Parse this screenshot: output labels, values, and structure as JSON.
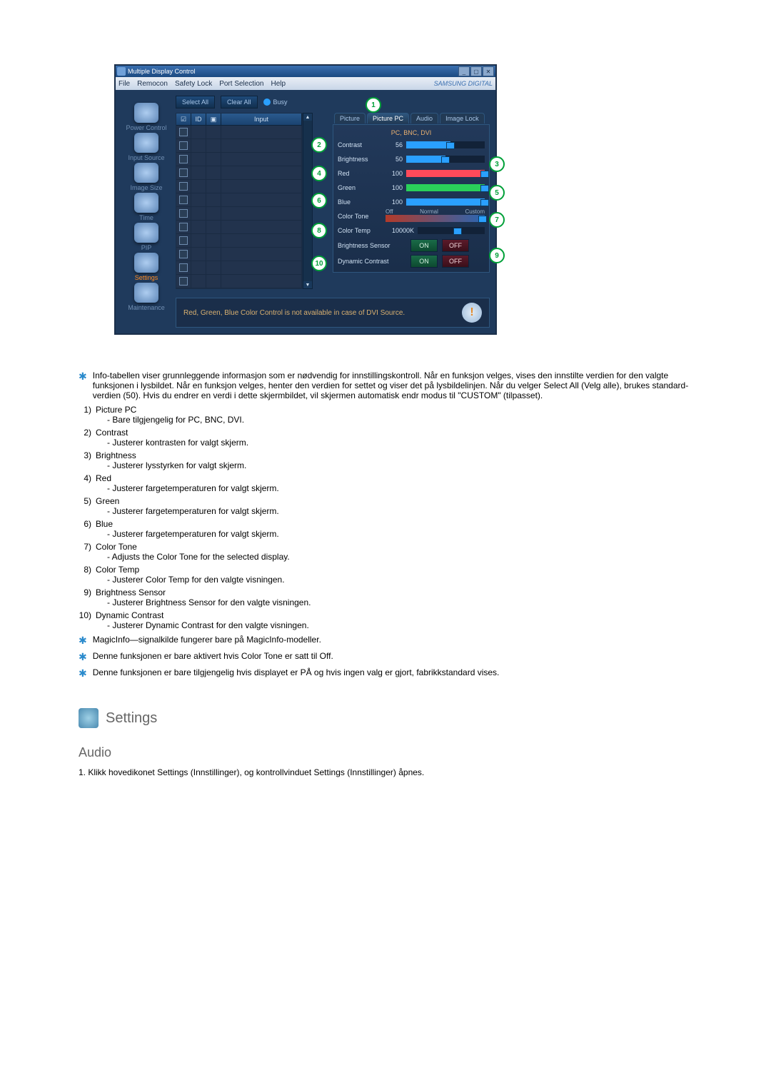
{
  "app": {
    "title": "Multiple Display Control",
    "menubar": [
      "File",
      "Remocon",
      "Safety Lock",
      "Port Selection",
      "Help"
    ],
    "brand": "SAMSUNG DIGITAL",
    "sidebar": [
      {
        "label": "Power Control"
      },
      {
        "label": "Input Source"
      },
      {
        "label": "Image Size"
      },
      {
        "label": "Time"
      },
      {
        "label": "PIP"
      },
      {
        "label": "Settings",
        "active": true
      },
      {
        "label": "Maintenance"
      }
    ],
    "buttons": {
      "select_all": "Select All",
      "clear_all": "Clear All",
      "busy": "Busy"
    },
    "table": {
      "headers": [
        "",
        "ID",
        "",
        "Input"
      ],
      "rows": 12
    },
    "callouts_top": "1",
    "callouts_right": [
      "3",
      "5",
      "7",
      "9"
    ],
    "callouts_left": [
      "2",
      "4",
      "6",
      "8",
      "10"
    ],
    "tabs": [
      "Picture",
      "Picture PC",
      "Audio",
      "Image Lock"
    ],
    "active_tab": "Picture PC",
    "src_label": "PC, BNC, DVI",
    "sliders": [
      {
        "label": "Contrast",
        "value": 56,
        "fill": 56,
        "color": "#2aa0ff"
      },
      {
        "label": "Brightness",
        "value": 50,
        "fill": 50,
        "color": "#2aa0ff"
      },
      {
        "label": "Red",
        "value": 100,
        "fill": 100,
        "color": "#ff4a5a"
      },
      {
        "label": "Green",
        "value": 100,
        "fill": 100,
        "color": "#2ad05a"
      },
      {
        "label": "Blue",
        "value": 100,
        "fill": 100,
        "color": "#2aa0ff"
      }
    ],
    "colortone": {
      "label": "Color Tone",
      "opts": [
        "Off",
        "Normal",
        "Custom"
      ],
      "sel": 2
    },
    "colortemp": {
      "label": "Color Temp",
      "value": "10000K",
      "fill": 60
    },
    "toggles": [
      {
        "label": "Brightness Sensor",
        "on": "ON",
        "off": "OFF"
      },
      {
        "label": "Dynamic Contrast",
        "on": "ON",
        "off": "OFF"
      }
    ],
    "footer_note": "Red, Green, Blue Color Control is not available in case of DVI Source."
  },
  "doc": {
    "star1": "Info-tabellen viser grunnleggende informasjon som er nødvendig for innstillingskontroll. Når en funksjon velges, vises den innstilte verdien for den valgte funksjonen i lysbildet. Når en funksjon velges, henter den verdien for settet og viser det på lysbildelinjen. Når du velger Select All (Velg alle), brukes standard-verdien (50). Hvis du endrer en verdi i dette skjermbildet, vil skjermen automatisk endr modus til \"CUSTOM\" (tilpasset).",
    "items": [
      {
        "n": "1)",
        "t": "Picture PC",
        "d": "- Bare tilgjengelig for PC, BNC, DVI."
      },
      {
        "n": "2)",
        "t": "Contrast",
        "d": "- Justerer kontrasten for valgt skjerm."
      },
      {
        "n": "3)",
        "t": "Brightness",
        "d": "- Justerer lysstyrken for valgt skjerm."
      },
      {
        "n": "4)",
        "t": "Red",
        "d": "- Justerer fargetemperaturen for valgt skjerm."
      },
      {
        "n": "5)",
        "t": "Green",
        "d": "- Justerer fargetemperaturen for valgt skjerm."
      },
      {
        "n": "6)",
        "t": "Blue",
        "d": "- Justerer fargetemperaturen for valgt skjerm."
      },
      {
        "n": "7)",
        "t": "Color Tone",
        "d": "- Adjusts the Color Tone for the selected display."
      },
      {
        "n": "8)",
        "t": "Color Temp",
        "d": "- Justerer Color Temp for den valgte visningen."
      },
      {
        "n": "9)",
        "t": "Brightness Sensor",
        "d": "- Justerer Brightness Sensor for den valgte visningen."
      },
      {
        "n": "10)",
        "t": "Dynamic Contrast",
        "d": "- Justerer Dynamic Contrast for den valgte visningen."
      }
    ],
    "star_notes": [
      "MagicInfo—signalkilde fungerer bare på MagicInfo-modeller.",
      "Denne funksjonen er bare aktivert hvis Color Tone er satt til Off.",
      "Denne funksjonen er bare tilgjengelig hvis displayet er PÅ og hvis ingen valg er gjort, fabrikkstandard vises."
    ],
    "section_title": "Settings",
    "subtitle": "Audio",
    "audio_step": "1. Klikk hovedikonet Settings (Innstillinger), og kontrollvinduet Settings (Innstillinger) åpnes."
  }
}
